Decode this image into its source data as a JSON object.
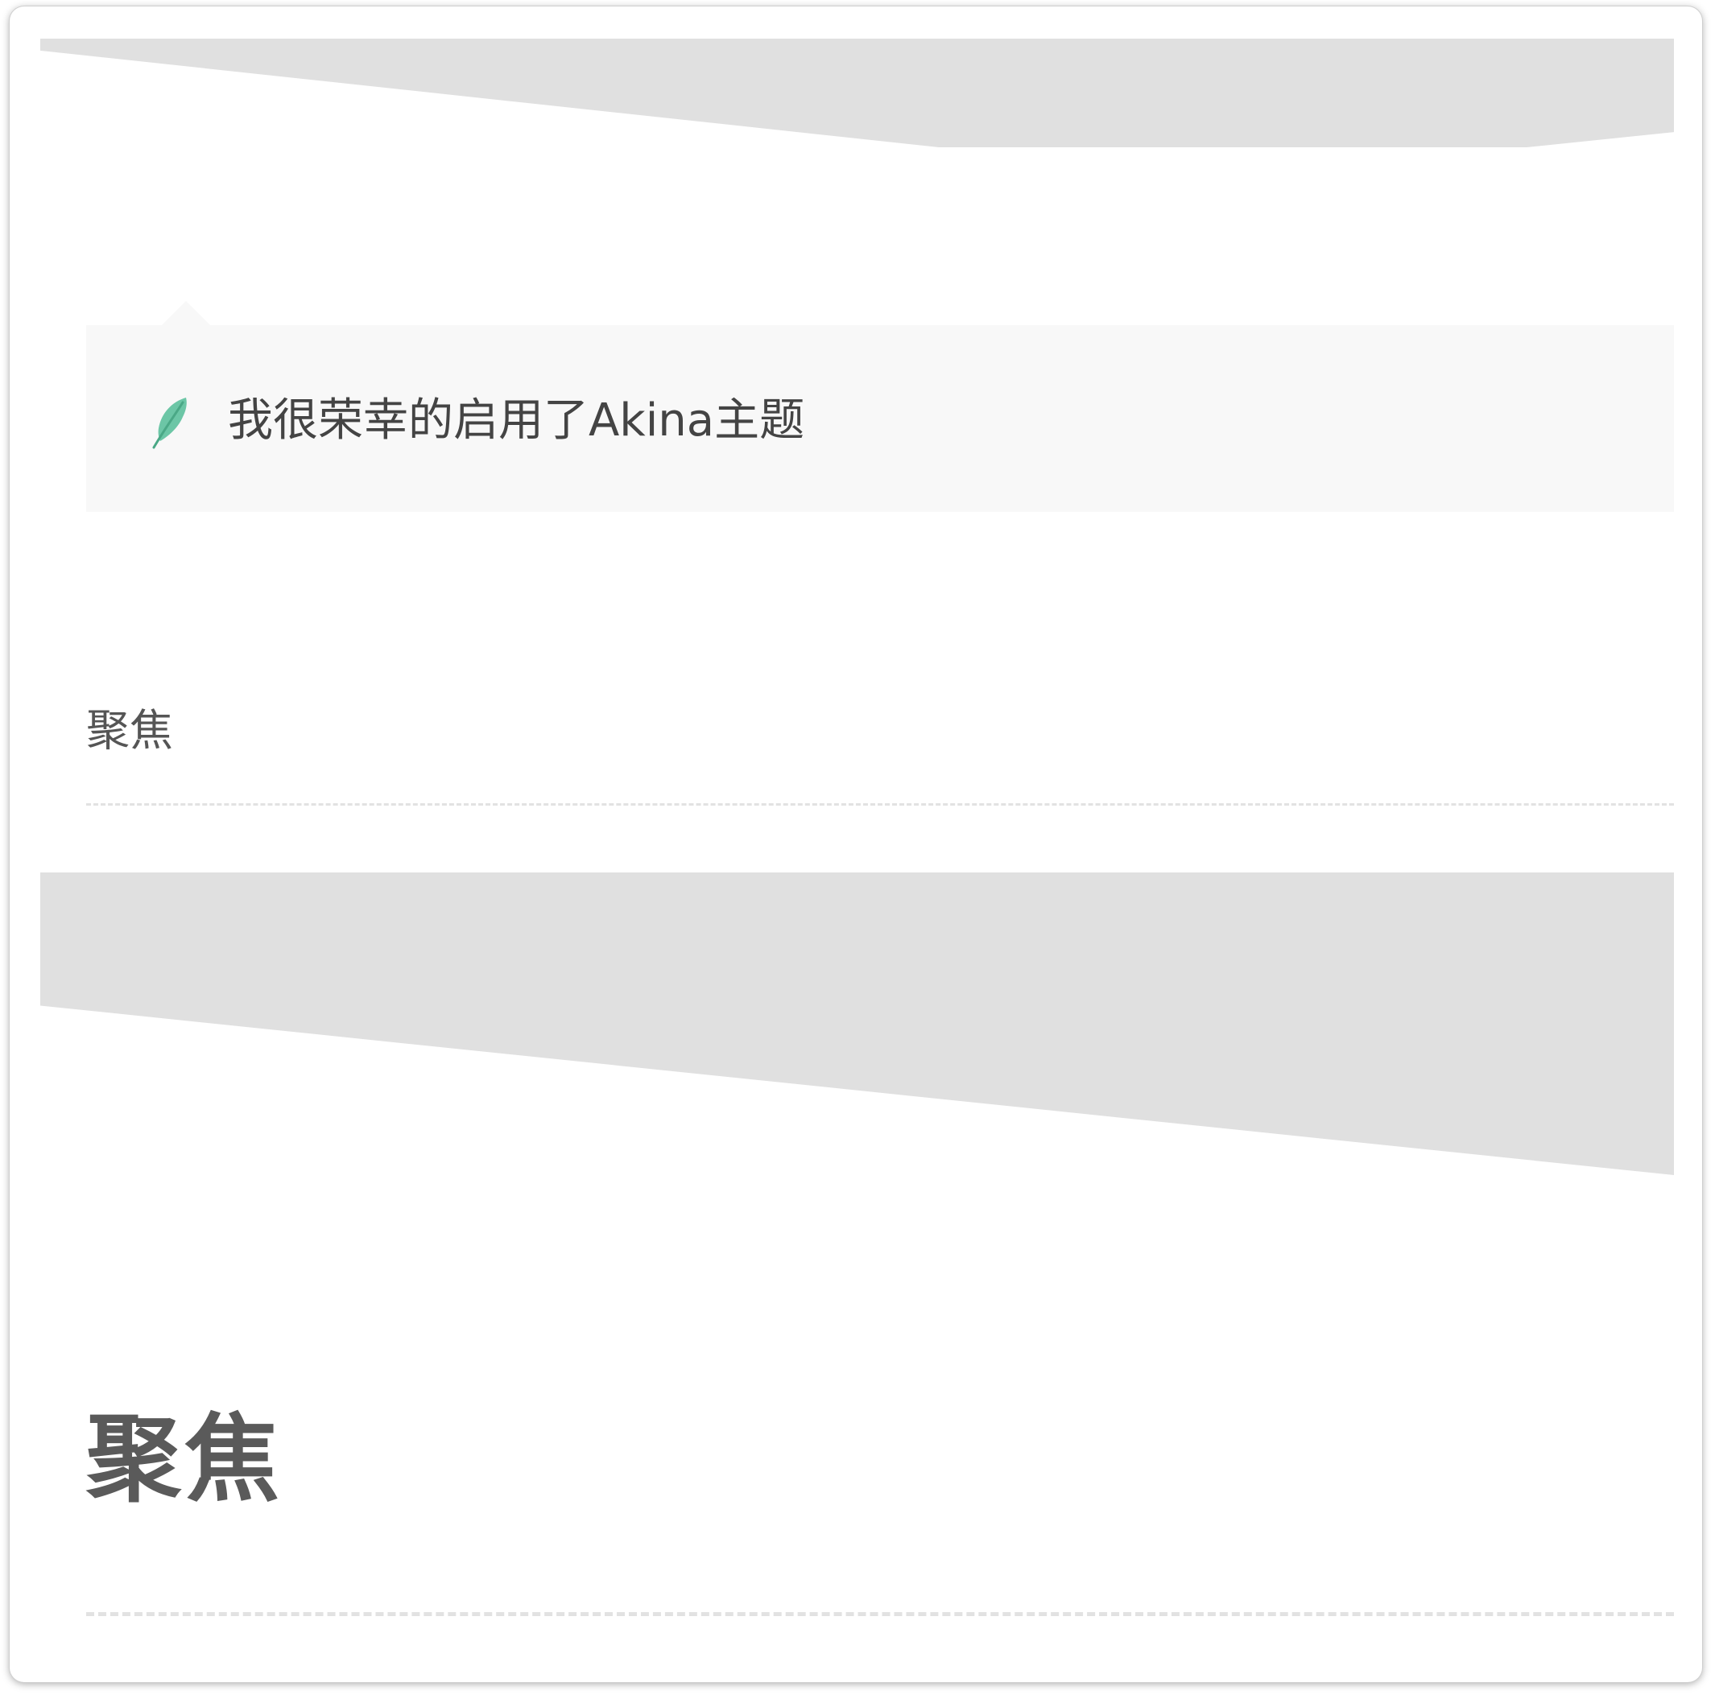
{
  "notice": {
    "text": "我很荣幸的启用了Akina主题",
    "icon": "feather-icon",
    "icon_color": "#6cc6a6"
  },
  "section_small": {
    "title": "聚焦"
  },
  "section_large": {
    "title": "聚焦"
  },
  "colors": {
    "banner_placeholder": "#e0e0e0",
    "notice_background": "#f8f8f8",
    "text": "#444444"
  }
}
